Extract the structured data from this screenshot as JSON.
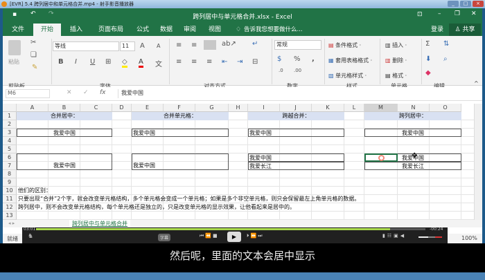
{
  "player": {
    "title": "[EVR] 5.4 跨列居中和单元格合并.mp4 - 射手影音播放器",
    "time_elapsed": "03:01",
    "time_remaining": "-00:24",
    "progress_percent": 91,
    "playlist_btn": "字幕",
    "subtitle": "然后呢，里面的文本会居中显示"
  },
  "excel": {
    "title": "跨列居中与单元格合并.xlsx - Excel",
    "tabs": [
      "文件",
      "开始",
      "插入",
      "页面布局",
      "公式",
      "数据",
      "审阅",
      "视图"
    ],
    "active_tab": "开始",
    "tell_me": "告诉我您想要做什么...",
    "login": "登录",
    "share": "共享"
  },
  "ribbon": {
    "paste": "粘贴",
    "font_name": "等线",
    "font_size": "11",
    "number_format": "常规",
    "conditional": "条件格式 ·",
    "table_format": "套用表格格式 ·",
    "cell_style": "单元格样式 ·",
    "insert": "插入",
    "delete": "删除",
    "format": "格式",
    "groups": [
      "剪贴板",
      "字体",
      "对齐方式",
      "数字",
      "样式",
      "单元格",
      "编辑"
    ],
    "accent": "#217346"
  },
  "formula": {
    "namebox": "M6",
    "fx": "fx",
    "value": "我爱中国"
  },
  "columns": [
    "A",
    "B",
    "C",
    "D",
    "E",
    "F",
    "G",
    "H",
    "I",
    "J",
    "K",
    "L",
    "M",
    "N",
    "O"
  ],
  "rows": [
    "1",
    "2",
    "3",
    "4",
    "5",
    "6",
    "7",
    "8",
    "9",
    "10",
    "11",
    "12",
    "13"
  ],
  "cells": {
    "h1": "合并居中：",
    "h2": "合并单元格：",
    "h3": "跨越合并：",
    "h4": "跨列居中：",
    "china": "我爱中国",
    "yangtze": "我爱长江",
    "r10": "他们的区别：",
    "r11": "只要出现“合并”2个字，就会改变单元格结构，多个单元格会变成一个单元格；如果是多个非空单元格，则只会保留最左上角单元格的数据。",
    "r12": "跨列居中，则不会改变单元格结构，每个单元格还是独立的，只是改变单元格的显示效果，让他看起来是居中的。"
  },
  "sheet_tab": "跨列居中与单元格合并",
  "status": {
    "ready": "就绪",
    "zoom": "100%"
  }
}
